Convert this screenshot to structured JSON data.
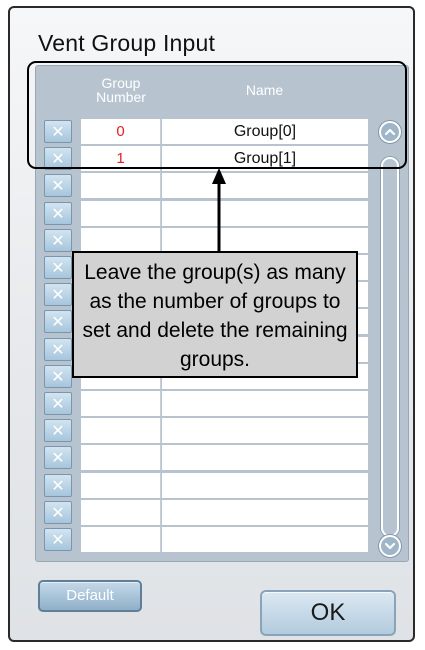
{
  "dialog": {
    "title": "Vent Group Input"
  },
  "table": {
    "headers": {
      "group_number": "Group\nNumber",
      "name": "Name"
    },
    "delete_glyph": "✕",
    "rows": [
      {
        "number": "0",
        "name": "Group[0]"
      },
      {
        "number": "1",
        "name": "Group[1]"
      },
      {
        "number": "",
        "name": ""
      },
      {
        "number": "",
        "name": ""
      },
      {
        "number": "",
        "name": ""
      },
      {
        "number": "",
        "name": ""
      },
      {
        "number": "",
        "name": ""
      },
      {
        "number": "",
        "name": ""
      },
      {
        "number": "",
        "name": ""
      },
      {
        "number": "",
        "name": ""
      },
      {
        "number": "",
        "name": ""
      },
      {
        "number": "",
        "name": ""
      },
      {
        "number": "",
        "name": ""
      },
      {
        "number": "",
        "name": ""
      },
      {
        "number": "",
        "name": ""
      },
      {
        "number": "",
        "name": ""
      }
    ]
  },
  "scrollbar": {
    "up_icon": "chevron-up-icon",
    "down_icon": "chevron-down-icon"
  },
  "callout": {
    "text": "Leave the group(s) as many as the number of groups to set and delete the remaining groups."
  },
  "buttons": {
    "default_label": "Default",
    "ok_label": "OK"
  },
  "colors": {
    "group_number_text": "#e22222",
    "panel_bg": "#b7c4d0",
    "callout_bg": "#d2d2d2"
  }
}
